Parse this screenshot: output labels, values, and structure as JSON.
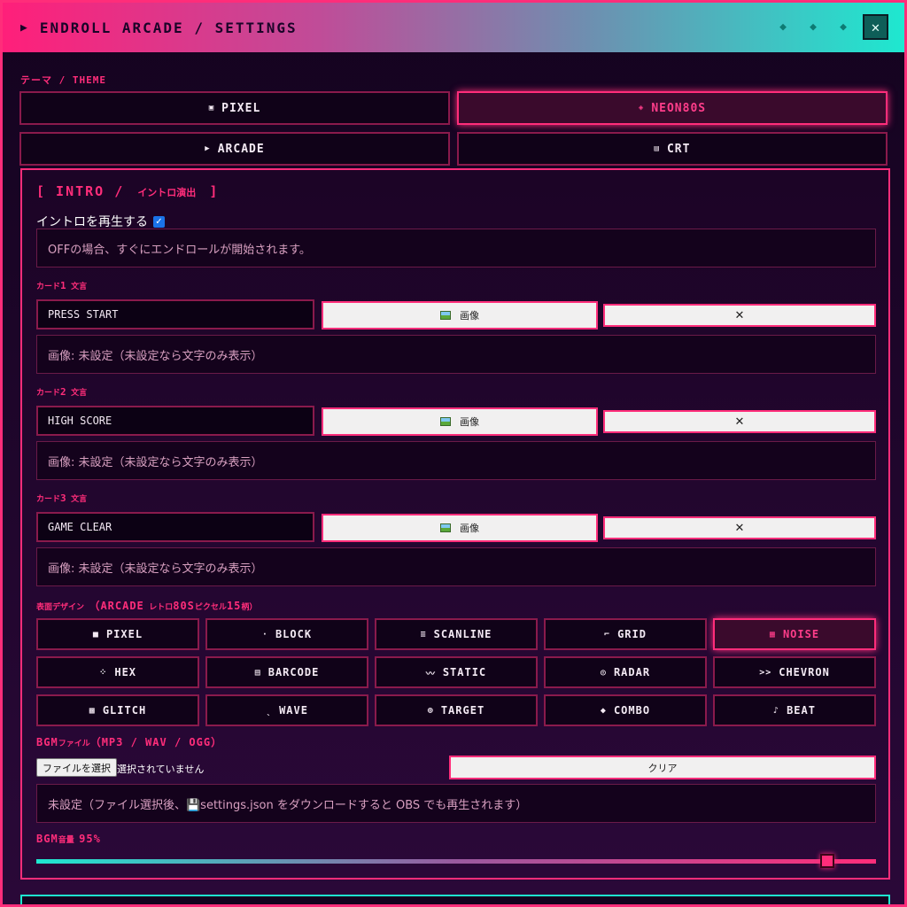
{
  "window": {
    "title": "ENDROLL ARCADE / SETTINGS",
    "arrow": "▶",
    "dots": [
      "◆",
      "◆",
      "◆"
    ],
    "close": "✕"
  },
  "theme": {
    "label": "テーマ / THEME",
    "options": [
      {
        "icon": "▣",
        "label": "PIXEL"
      },
      {
        "icon": "◈",
        "label": "NEON80S",
        "active": true
      },
      {
        "icon": "▶",
        "label": "ARCADE"
      },
      {
        "icon": "▤",
        "label": "CRT"
      }
    ]
  },
  "intro": {
    "title_open": "[ INTRO /",
    "title_jp": "イントロ演出",
    "title_close": "]",
    "toggle_label": "イントロを再生する",
    "toggle_checked": true,
    "toggle_note": "OFFの場合、すぐにエンドロールが開始されます。"
  },
  "cards": [
    {
      "label_pre": "カード",
      "num": "1",
      "label_post": "文言",
      "text": "PRESS START",
      "image_button": "画像",
      "clear": "✕",
      "status": "画像: 未設定（未設定なら文字のみ表示）"
    },
    {
      "label_pre": "カード",
      "num": "2",
      "label_post": "文言",
      "text": "HIGH SCORE",
      "image_button": "画像",
      "clear": "✕",
      "status": "画像: 未設定（未設定なら文字のみ表示）"
    },
    {
      "label_pre": "カード",
      "num": "3",
      "label_post": "文言",
      "text": "GAME CLEAR",
      "image_button": "画像",
      "clear": "✕",
      "status": "画像: 未設定（未設定なら文字のみ表示）"
    }
  ],
  "design": {
    "label_pre": "表面デザイン",
    "label_main": "（ARCADE",
    "label_mid": "レトロ",
    "label_num1": "80S",
    "label_mid2": "ピクセル",
    "label_num2": "15",
    "label_end": "柄）",
    "patterns": [
      {
        "icon": "■",
        "label": "PIXEL"
      },
      {
        "icon": "·",
        "label": "BLOCK"
      },
      {
        "icon": "≡",
        "label": "SCANLINE"
      },
      {
        "icon": "⌐",
        "label": "GRID"
      },
      {
        "icon": "▦",
        "label": "NOISE",
        "active": true
      },
      {
        "icon": "⁘",
        "label": "HEX"
      },
      {
        "icon": "▤",
        "label": "BARCODE"
      },
      {
        "icon": "〰",
        "label": "STATIC"
      },
      {
        "icon": "◎",
        "label": "RADAR"
      },
      {
        "icon": ">>",
        "label": "CHEVRON"
      },
      {
        "icon": "▩",
        "label": "GLITCH"
      },
      {
        "icon": "ˎ",
        "label": "WAVE"
      },
      {
        "icon": "⊕",
        "label": "TARGET"
      },
      {
        "icon": "◆",
        "label": "COMBO"
      },
      {
        "icon": "♪",
        "label": "BEAT"
      }
    ]
  },
  "bgm": {
    "label_main": "BGM",
    "label_jp": "ファイル",
    "label_formats": "（MP3 / WAV / OGG）",
    "choose_file": "ファイルを選択",
    "file_status": "選択されていません",
    "clear": "クリア",
    "status": "未設定（ファイル選択後、💾settings.json をダウンロードすると OBS でも再生されます）",
    "volume_main": "BGM",
    "volume_jp": "音量",
    "volume_value": "95%",
    "volume": 95
  }
}
